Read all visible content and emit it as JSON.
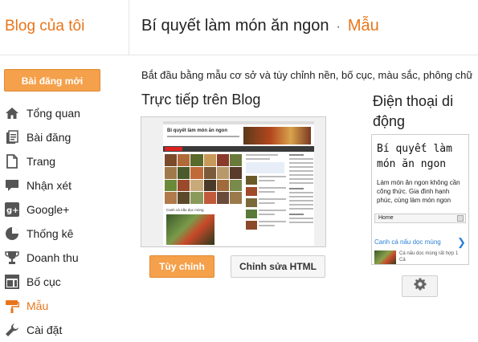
{
  "header": {
    "brand": "Blog của tôi",
    "blog_title": "Bí quyết làm món ăn ngon",
    "separator": "·",
    "current_section": "Mẫu"
  },
  "sidebar": {
    "new_post_label": "Bài đăng mới",
    "items": [
      {
        "label": "Tổng quan",
        "icon": "home-icon"
      },
      {
        "label": "Bài đăng",
        "icon": "posts-icon"
      },
      {
        "label": "Trang",
        "icon": "pages-icon"
      },
      {
        "label": "Nhận xét",
        "icon": "comments-icon"
      },
      {
        "label": "Google+",
        "icon": "google-plus-icon"
      },
      {
        "label": "Thống kê",
        "icon": "stats-icon"
      },
      {
        "label": "Doanh thu",
        "icon": "trophy-icon"
      },
      {
        "label": "Bố cục",
        "icon": "layout-icon"
      },
      {
        "label": "Mẫu",
        "icon": "template-icon"
      },
      {
        "label": "Cài đặt",
        "icon": "wrench-icon"
      }
    ],
    "active_index": 8
  },
  "main": {
    "intro": "Bắt đầu bằng mẫu cơ sở và tùy chỉnh nền, bố cục, màu sắc, phông chữ",
    "live_title": "Trực tiếp trên Blog",
    "mobile_title": "Điện thoại di động",
    "customize_label": "Tùy chỉnh",
    "edit_html_label": "Chỉnh sửa HTML",
    "live_preview": {
      "blog_title": "Bí quyết làm món ăn ngon",
      "post_caption": "Canh cá nấu dọc mùng"
    },
    "mobile_preview": {
      "title": "Bí quyết làm món ăn ngon",
      "description": "Làm món ăn ngon không cần cõng thức. Gia đình hạnh phúc, cùng làm món ngon",
      "menu_selected": "Home",
      "post_link": "Canh cá nấu dọc mùng",
      "post_snippet": "Cá nấu dọc mùng rất hợp 1 Cả"
    }
  },
  "colors": {
    "accent": "#e8751a",
    "button_orange": "#f5a04a",
    "link_blue": "#2a7fd4"
  }
}
